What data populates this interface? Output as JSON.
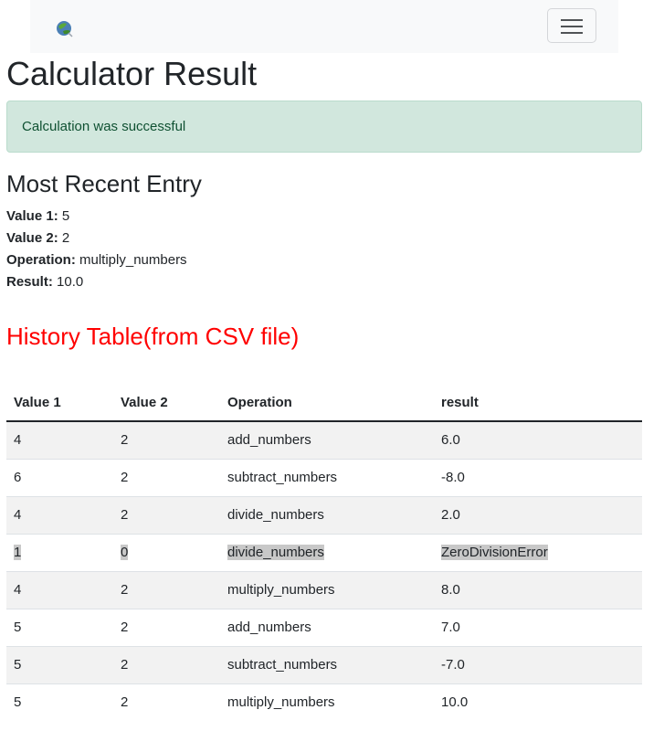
{
  "navbar": {
    "logo_icon": "globe-leaf-icon",
    "toggler_icon": "hamburger-menu-icon"
  },
  "page_title": "Calculator Result",
  "alert": {
    "message": "Calculation was successful",
    "color": "#d1e7dd"
  },
  "recent": {
    "heading": "Most Recent Entry",
    "value1_label": "Value 1:",
    "value1": "5",
    "value2_label": "Value 2:",
    "value2": "2",
    "operation_label": "Operation:",
    "operation": "multiply_numbers",
    "result_label": "Result:",
    "result": "10.0"
  },
  "history": {
    "heading": "History Table(from CSV file)",
    "heading_color": "#ff0000",
    "columns": [
      "Value 1",
      "Value 2",
      "Operation",
      "result"
    ],
    "rows": [
      [
        "4",
        "2",
        "add_numbers",
        "6.0"
      ],
      [
        "6",
        "2",
        "subtract_numbers",
        "-8.0"
      ],
      [
        "4",
        "2",
        "divide_numbers",
        "2.0"
      ],
      [
        "1",
        "0",
        "divide_numbers",
        "ZeroDivisionError"
      ],
      [
        "4",
        "2",
        "multiply_numbers",
        "8.0"
      ],
      [
        "5",
        "2",
        "add_numbers",
        "7.0"
      ],
      [
        "5",
        "2",
        "subtract_numbers",
        "-7.0"
      ],
      [
        "5",
        "2",
        "multiply_numbers",
        "10.0"
      ]
    ]
  }
}
